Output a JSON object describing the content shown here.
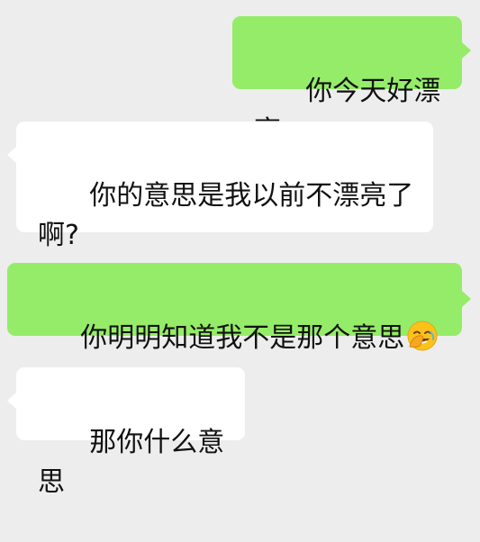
{
  "messages": [
    {
      "side": "sent",
      "text": "你今天好漂亮"
    },
    {
      "side": "received",
      "text": "你的意思是我以前不漂亮了\n啊?"
    },
    {
      "side": "sent",
      "text": "你明明知道我不是那个意思",
      "emoji": "face-palm-laughing-icon"
    },
    {
      "side": "received",
      "text": "那你什么意思"
    }
  ],
  "colors": {
    "background": "#ededed",
    "sent_bubble": "#95ec69",
    "received_bubble": "#ffffff",
    "text": "#111111"
  }
}
